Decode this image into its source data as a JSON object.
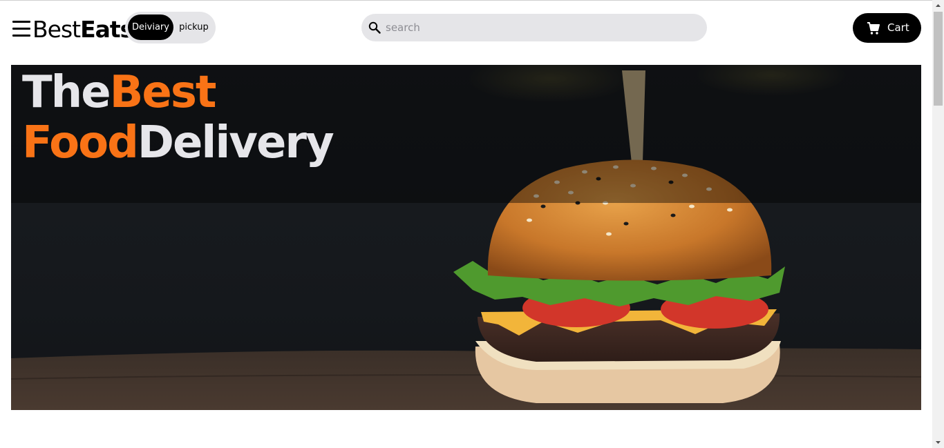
{
  "header": {
    "brand": {
      "part1": "Best",
      "part2": "Eats"
    },
    "mode": {
      "active_label": "Deiviary",
      "inactive_label": "pickup"
    },
    "search": {
      "placeholder": "search",
      "value": ""
    },
    "cart": {
      "label": "Cart"
    }
  },
  "hero": {
    "line1": {
      "white": "The",
      "orange": "Best"
    },
    "line2": {
      "orange": "Food",
      "white": "Delivery"
    },
    "accent_color": "#f97316"
  },
  "icons": {
    "menu": "hamburger-menu-icon",
    "search": "magnifier-search-icon",
    "cart": "shopping-cart-icon"
  }
}
